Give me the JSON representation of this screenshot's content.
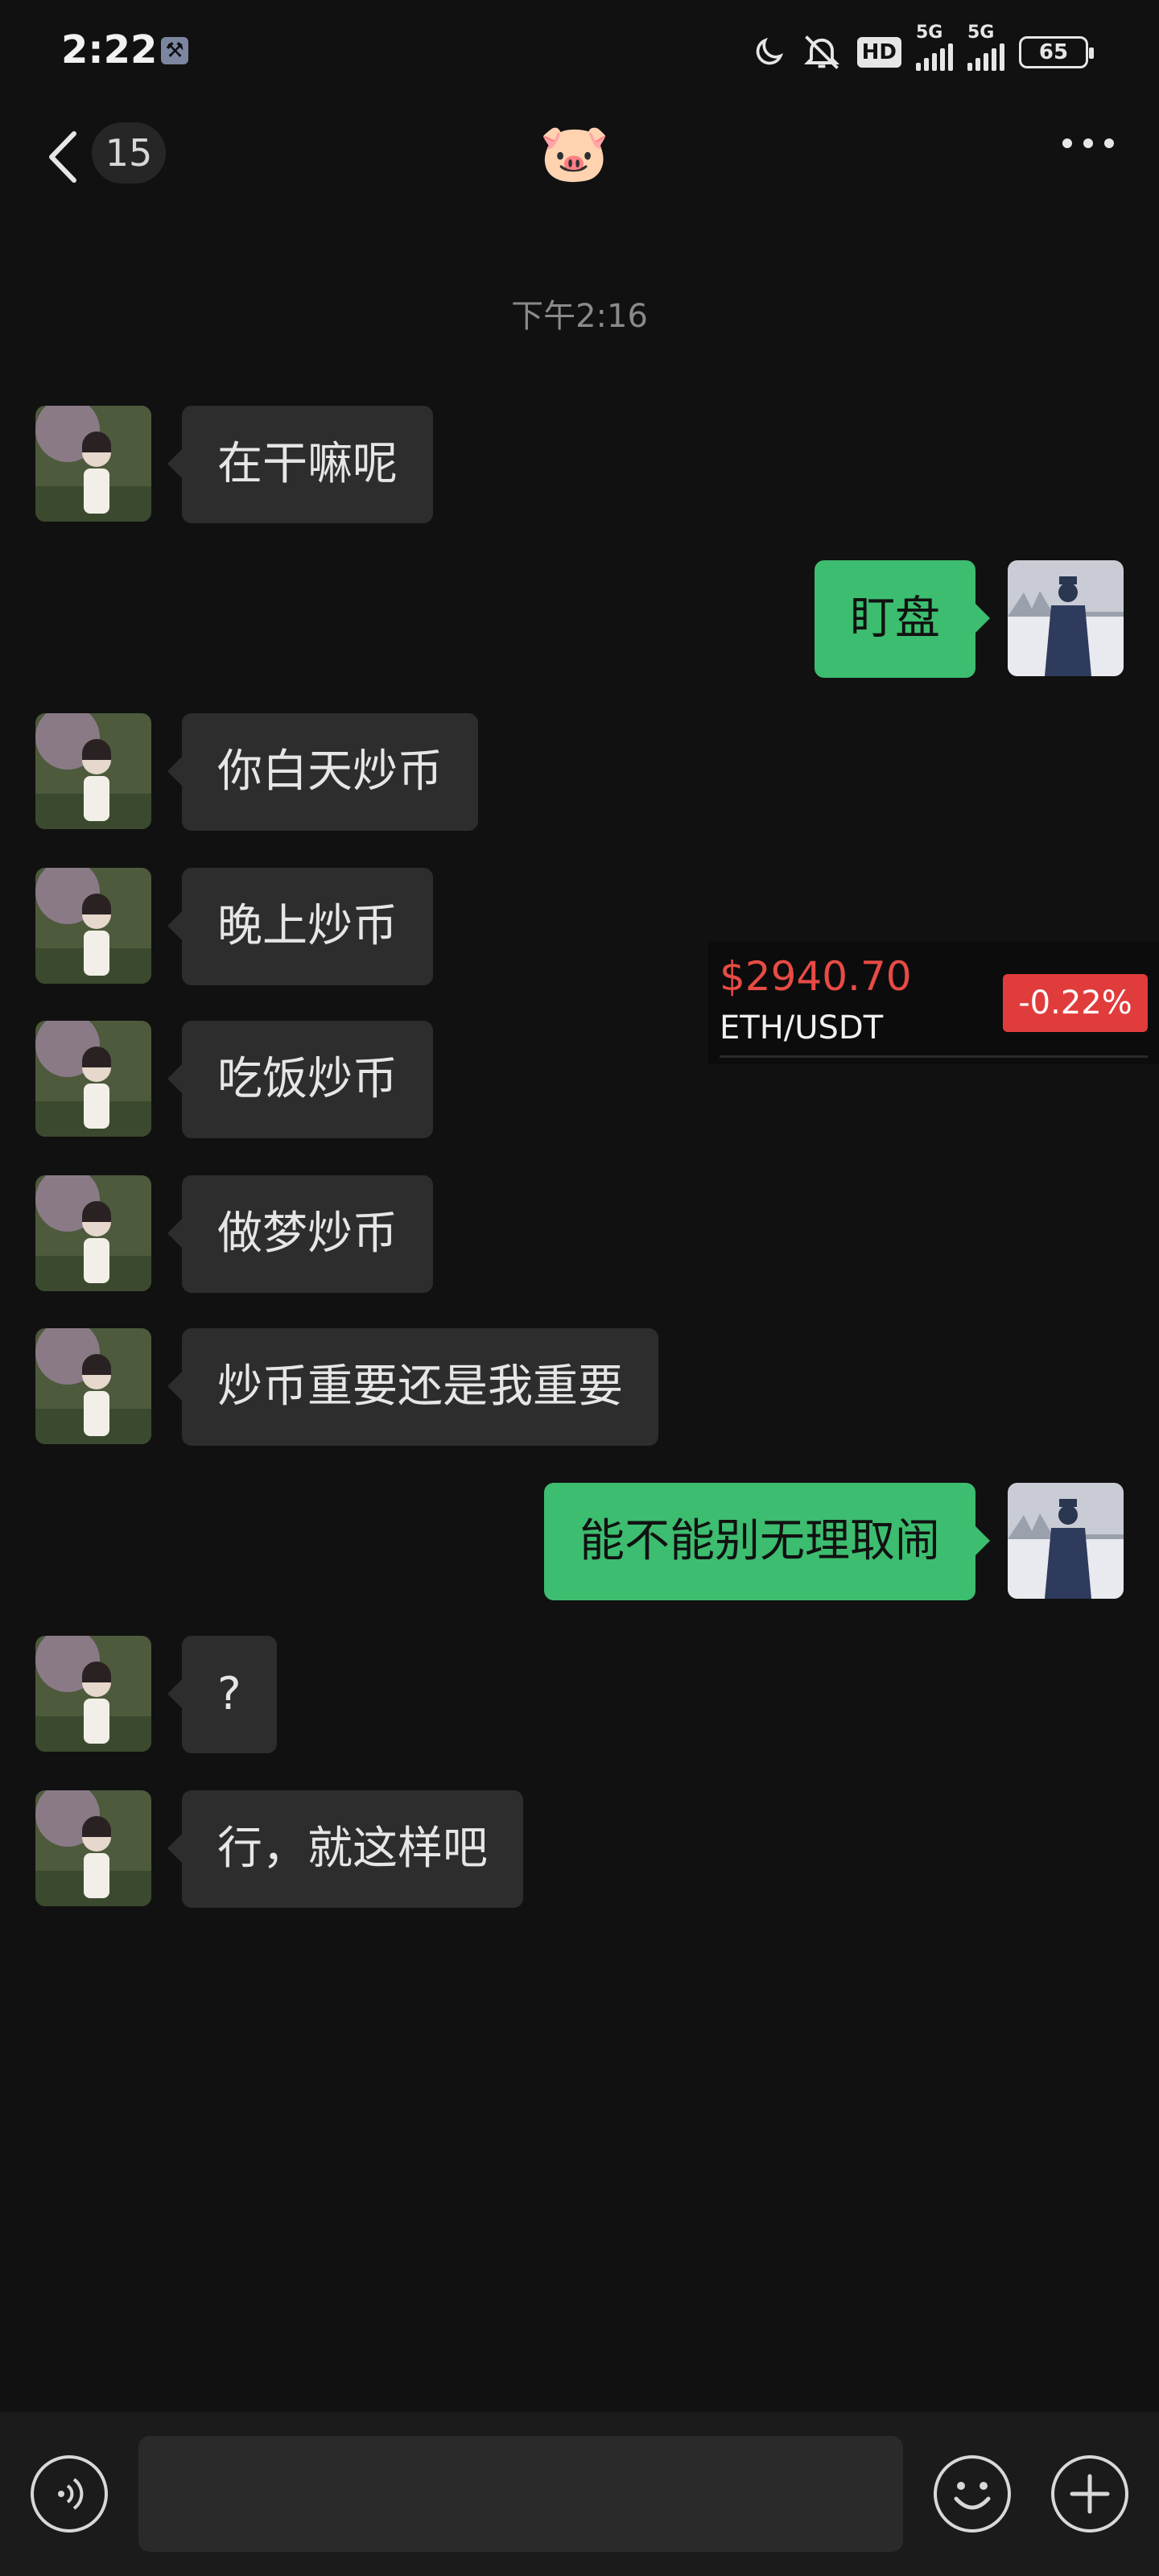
{
  "status_bar": {
    "time": "2:22",
    "hd_label": "HD",
    "network_1": "5G",
    "network_2": "5G",
    "battery": "65"
  },
  "header": {
    "unread_count": "15",
    "title_emoji": "🐷"
  },
  "timestamp": "下午2:16",
  "messages": [
    {
      "side": "in",
      "text": "在干嘛呢"
    },
    {
      "side": "out",
      "text": "盯盘"
    },
    {
      "side": "in",
      "text": "你白天炒币"
    },
    {
      "side": "in",
      "text": "晚上炒币"
    },
    {
      "side": "in",
      "text": "吃饭炒币"
    },
    {
      "side": "in",
      "text": "做梦炒币"
    },
    {
      "side": "in",
      "text": "炒币重要还是我重要"
    },
    {
      "side": "out",
      "text": "能不能别无理取闹"
    },
    {
      "side": "in",
      "text": "?"
    },
    {
      "side": "in",
      "text": "行，就这样吧"
    }
  ],
  "ticker": {
    "price": "$2940.70",
    "pair": "ETH/USDT",
    "change": "-0.22%"
  },
  "input_bar": {
    "placeholder": ""
  },
  "colors": {
    "background": "#111111",
    "incoming_bubble": "#2d2d2d",
    "outgoing_bubble": "#3dbd6f",
    "price_red": "#e84b45",
    "change_badge": "#e13c3c"
  }
}
